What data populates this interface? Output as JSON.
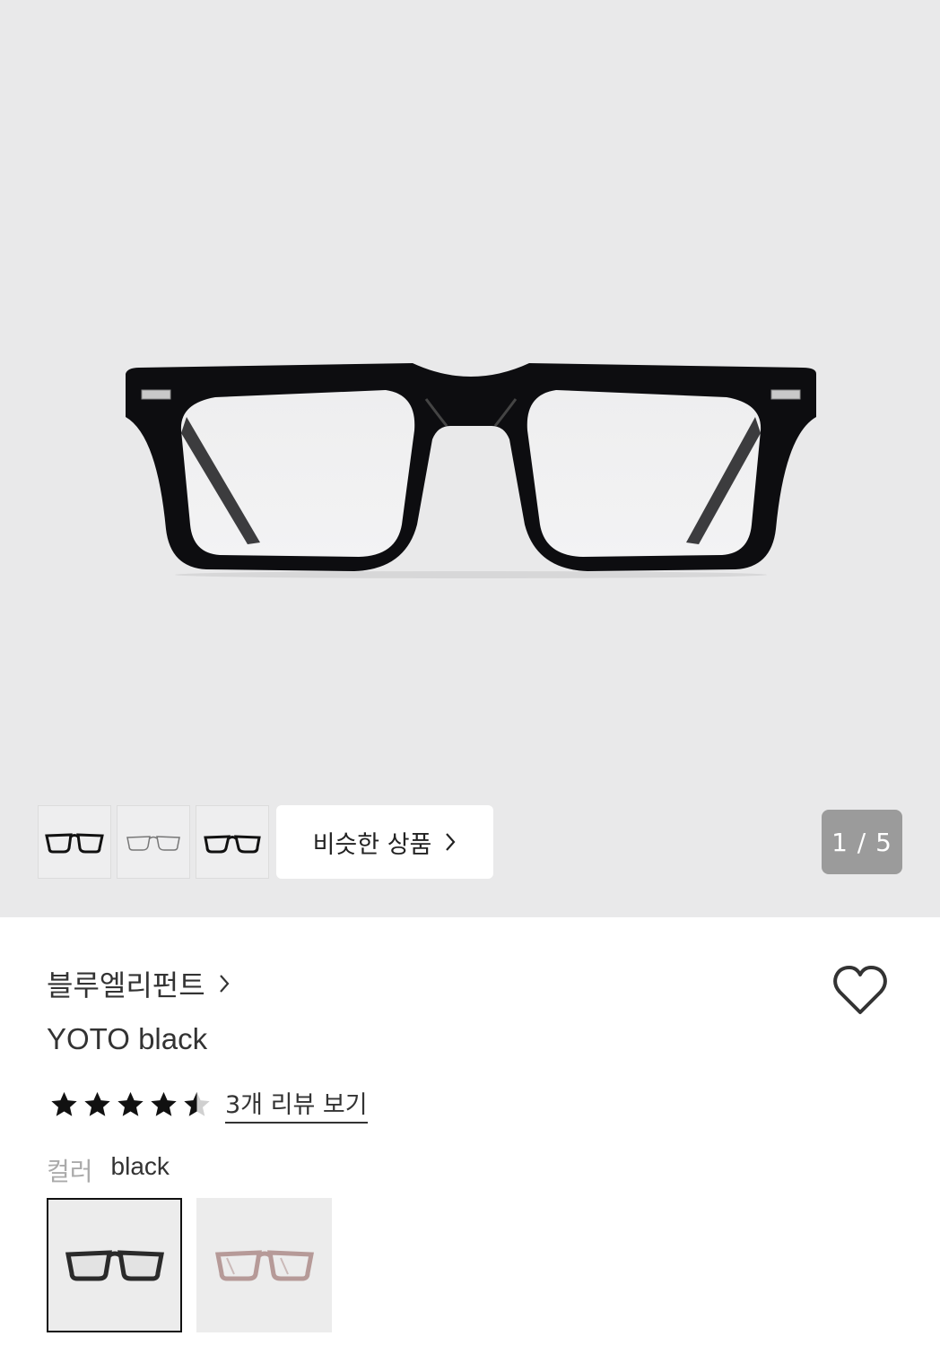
{
  "gallery": {
    "main_image": "black-rectangle-eyeglasses",
    "thumbnails": [
      "black-glasses-front",
      "clear-glasses-front",
      "black-glasses-angle"
    ],
    "similar_label": "비슷한 상품",
    "pager": "1 / 5"
  },
  "product": {
    "brand": "블루엘리펀트",
    "name": "YOTO black",
    "rating": 4.5,
    "rating_max": 5,
    "review_link": "3개 리뷰 보기",
    "color_label": "컬러",
    "color_value": "black",
    "swatches": [
      {
        "name": "black",
        "frame_color": "#2a2a2a",
        "selected": true
      },
      {
        "name": "pink",
        "frame_color": "#b69a98",
        "selected": false
      }
    ]
  },
  "colors": {
    "hero_bg": "#e9e9ea",
    "pager_bg": "#9b9b9b",
    "star": "#111111"
  }
}
